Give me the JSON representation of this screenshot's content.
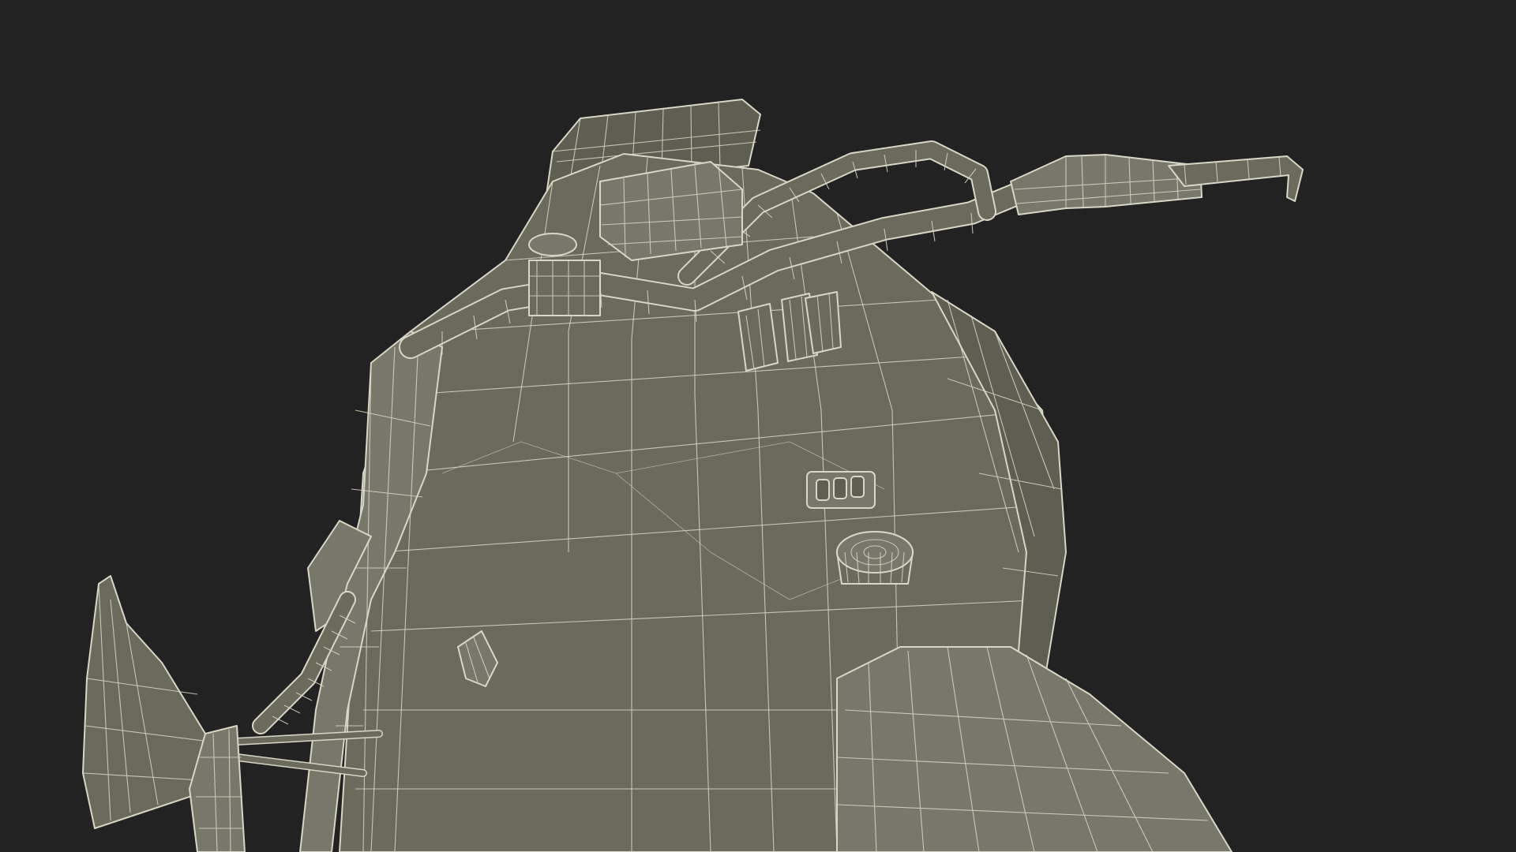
{
  "scene": {
    "background_color": "#222222",
    "mesh_fill_color": "#6b6b5c",
    "wire_color": "#d8d6c4",
    "subject": "snowmobile-wireframe-render"
  }
}
